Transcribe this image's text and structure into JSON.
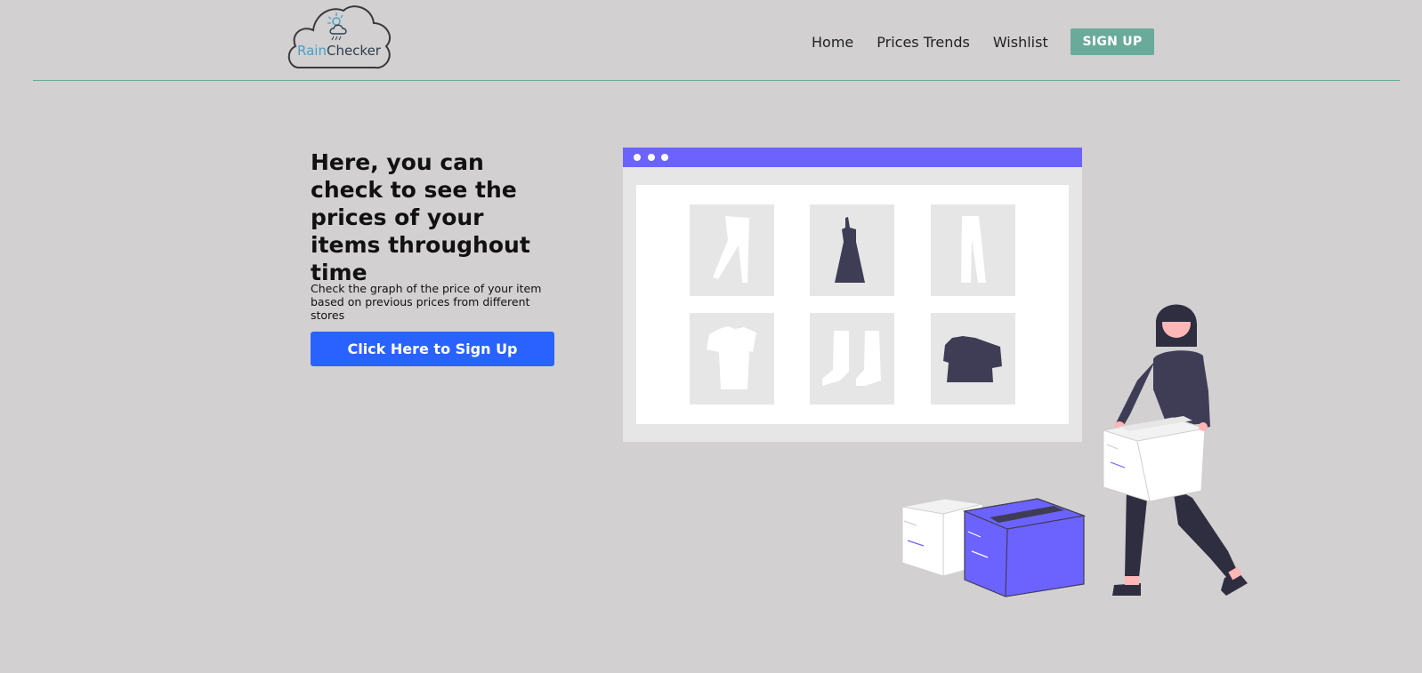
{
  "header": {
    "logo": {
      "part1": "Rain",
      "part2": "Checker",
      "accent": "#4a9fc4"
    },
    "nav": [
      {
        "label": "Home"
      },
      {
        "label": "Prices Trends"
      },
      {
        "label": "Wishlist"
      }
    ],
    "signup_label": "SIGN UP",
    "signup_color": "#6aaa9b"
  },
  "hero": {
    "title": "Here, you can check to see the prices of your items throughout time",
    "description": "Check the graph of the price of your item based on previous prices from different stores",
    "cta_label": "Click Here to Sign Up",
    "cta_color": "#2962ff"
  },
  "illustration": {
    "accent": "#6c63ff",
    "dark": "#3f3d56",
    "items": [
      "pants-icon",
      "dress-icon",
      "trousers-icon",
      "tshirt-icon",
      "boots-icon",
      "crop-top-icon"
    ]
  }
}
